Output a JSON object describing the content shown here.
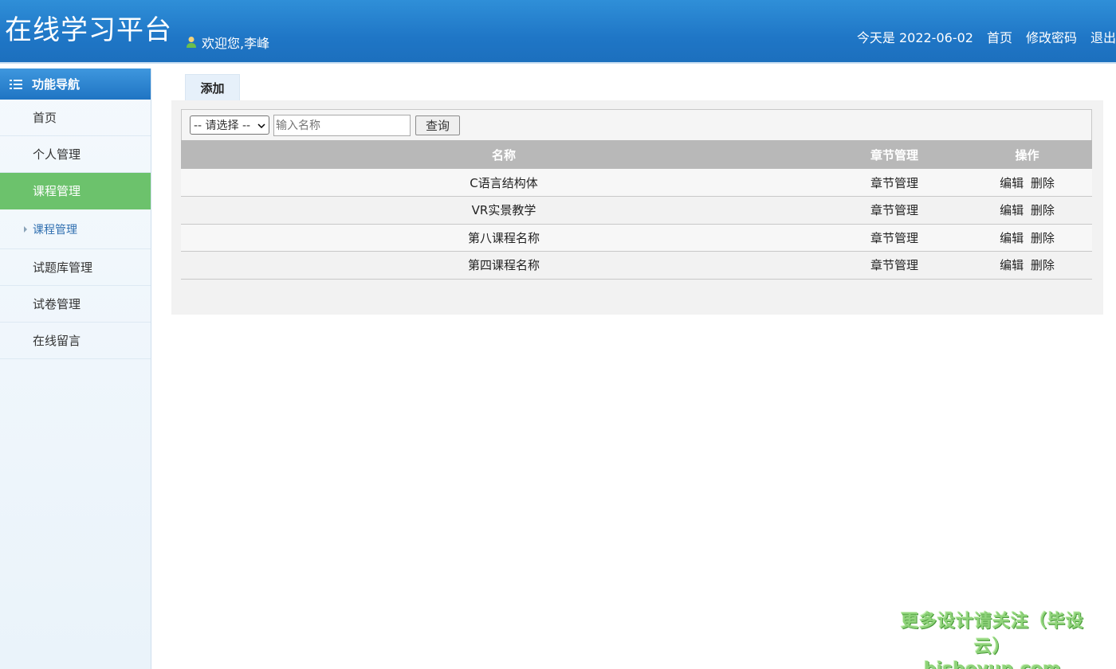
{
  "header": {
    "logo": "在线学习平台",
    "welcome": "欢迎您,李峰",
    "date_text": "今天是 2022-06-02",
    "links": [
      "首页",
      "修改密码",
      "退出"
    ]
  },
  "sidebar": {
    "title": "功能导航",
    "items": [
      {
        "label": "首页"
      },
      {
        "label": "个人管理"
      },
      {
        "label": "课程管理"
      },
      {
        "label": "课程管理"
      },
      {
        "label": "试题库管理"
      },
      {
        "label": "试卷管理"
      },
      {
        "label": "在线留言"
      }
    ]
  },
  "main": {
    "tab_add": "添加",
    "filter": {
      "select_value": "-- 请选择 --",
      "input_placeholder": "输入名称",
      "query_button": "查询"
    },
    "table": {
      "headers": [
        "名称",
        "章节管理",
        "操作"
      ],
      "rows": [
        {
          "name": "C语言结构体",
          "chapter": "章节管理",
          "edit": "编辑",
          "delete": "删除"
        },
        {
          "name": "VR实景教学",
          "chapter": "章节管理",
          "edit": "编辑",
          "delete": "删除"
        },
        {
          "name": "第八课程名称",
          "chapter": "章节管理",
          "edit": "编辑",
          "delete": "删除"
        },
        {
          "name": "第四课程名称",
          "chapter": "章节管理",
          "edit": "编辑",
          "delete": "删除"
        }
      ]
    }
  },
  "watermark": {
    "line1": "更多设计请关注（毕设云）",
    "line2": "bisheyun.com"
  },
  "colors": {
    "header_blue": "#1f76c6",
    "active_green": "#6cc26c",
    "table_header_gray": "#b8b8b8"
  }
}
